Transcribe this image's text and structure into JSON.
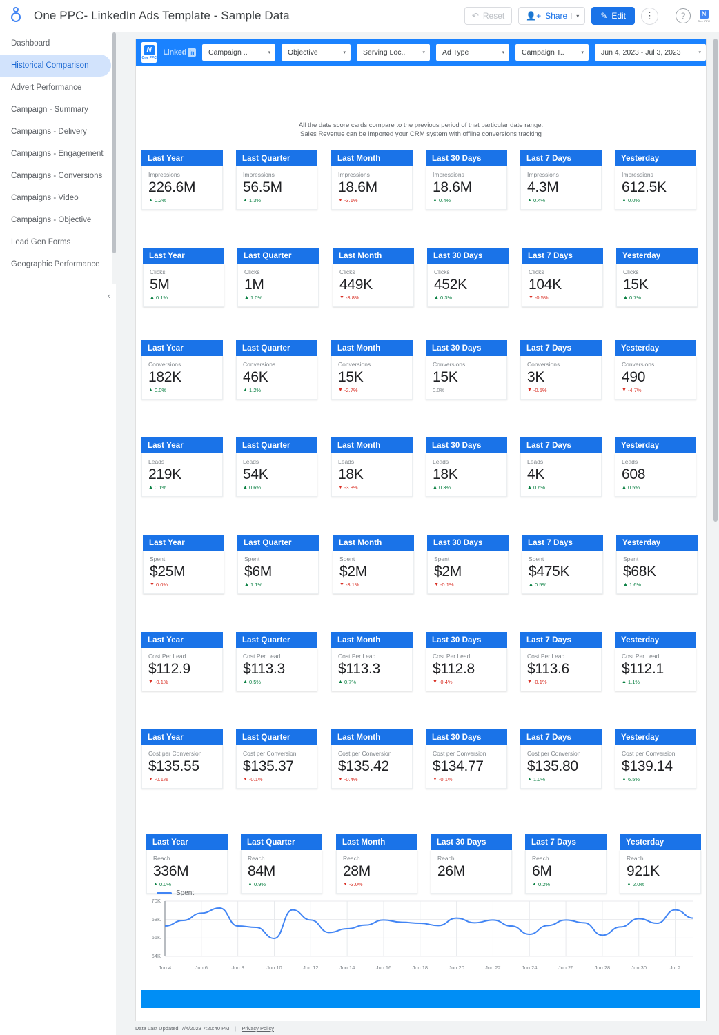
{
  "topbar": {
    "title": "One PPC- LinkedIn Ads Template - Sample Data",
    "reset_label": "Reset",
    "share_label": "Share",
    "share_caret": "▾",
    "edit_label": "Edit",
    "more_icon": "⋮",
    "help_icon": "?",
    "logo_mark": "N",
    "logo_text": "One PPC"
  },
  "sidebar": {
    "items": [
      {
        "label": "Dashboard",
        "active": false
      },
      {
        "label": "Historical Comparison",
        "active": true
      },
      {
        "label": "Advert Performance",
        "active": false
      },
      {
        "label": "Campaign - Summary",
        "active": false
      },
      {
        "label": "Campaigns - Delivery",
        "active": false
      },
      {
        "label": "Campaigns - Engagement",
        "active": false
      },
      {
        "label": "Campaigns - Conversions",
        "active": false
      },
      {
        "label": "Campaigns - Video",
        "active": false
      },
      {
        "label": "Campaigns - Objective",
        "active": false
      },
      {
        "label": "Lead Gen Forms",
        "active": false
      },
      {
        "label": "Geographic Performance",
        "active": false
      }
    ],
    "collapse_icon": "‹"
  },
  "filterbar": {
    "brand_mark": "N",
    "brand_text": "One PPC",
    "linkedin_word": "Linked",
    "linkedin_in": "in",
    "filters": [
      {
        "label": "Campaign ..",
        "caret": "▾"
      },
      {
        "label": "Objective",
        "caret": "▾"
      },
      {
        "label": "Serving Loc..",
        "caret": "▾"
      },
      {
        "label": "Ad Type",
        "caret": "▾"
      },
      {
        "label": "Campaign T..",
        "caret": "▾"
      },
      {
        "label": "Jun 4, 2023 - Jul 3, 2023",
        "caret": "▾"
      }
    ]
  },
  "note": {
    "line1": "All the date score cards compare to the previous period of that particular date range.",
    "line2": "Sales Revenue can be imported your CRM system with offline conversions tracking"
  },
  "periods": [
    "Last Year",
    "Last Quarter",
    "Last Month",
    "Last 30 Days",
    "Last 7 Days",
    "Yesterday"
  ],
  "scorecards": [
    {
      "metric": "Impressions",
      "cells": [
        {
          "value": "226.6M",
          "delta": "0.2%",
          "dir": "up"
        },
        {
          "value": "56.5M",
          "delta": "1.3%",
          "dir": "up"
        },
        {
          "value": "18.6M",
          "delta": "-3.1%",
          "dir": "down"
        },
        {
          "value": "18.6M",
          "delta": "0.4%",
          "dir": "up"
        },
        {
          "value": "4.3M",
          "delta": "0.4%",
          "dir": "up"
        },
        {
          "value": "612.5K",
          "delta": "0.0%",
          "dir": "up"
        }
      ]
    },
    {
      "metric": "Clicks",
      "cells": [
        {
          "value": "5M",
          "delta": "0.1%",
          "dir": "up"
        },
        {
          "value": "1M",
          "delta": "1.0%",
          "dir": "up"
        },
        {
          "value": "449K",
          "delta": "-3.8%",
          "dir": "down"
        },
        {
          "value": "452K",
          "delta": "0.3%",
          "dir": "up"
        },
        {
          "value": "104K",
          "delta": "-0.5%",
          "dir": "down"
        },
        {
          "value": "15K",
          "delta": "0.7%",
          "dir": "up"
        }
      ]
    },
    {
      "metric": "Conversions",
      "cells": [
        {
          "value": "182K",
          "delta": "0.0%",
          "dir": "up"
        },
        {
          "value": "46K",
          "delta": "1.2%",
          "dir": "up"
        },
        {
          "value": "15K",
          "delta": "-2.7%",
          "dir": "down"
        },
        {
          "value": "15K",
          "delta": "0.0%",
          "dir": "flat"
        },
        {
          "value": "3K",
          "delta": "-0.5%",
          "dir": "down"
        },
        {
          "value": "490",
          "delta": "-4.7%",
          "dir": "down"
        }
      ]
    },
    {
      "metric": "Leads",
      "cells": [
        {
          "value": "219K",
          "delta": "0.1%",
          "dir": "up"
        },
        {
          "value": "54K",
          "delta": "0.6%",
          "dir": "up"
        },
        {
          "value": "18K",
          "delta": "-3.8%",
          "dir": "down"
        },
        {
          "value": "18K",
          "delta": "0.3%",
          "dir": "up"
        },
        {
          "value": "4K",
          "delta": "0.6%",
          "dir": "up"
        },
        {
          "value": "608",
          "delta": "0.5%",
          "dir": "up"
        }
      ]
    },
    {
      "metric": "Spent",
      "cells": [
        {
          "value": "$25M",
          "delta": "0.0%",
          "dir": "down"
        },
        {
          "value": "$6M",
          "delta": "1.1%",
          "dir": "up"
        },
        {
          "value": "$2M",
          "delta": "-3.1%",
          "dir": "down"
        },
        {
          "value": "$2M",
          "delta": "-0.1%",
          "dir": "down"
        },
        {
          "value": "$475K",
          "delta": "0.5%",
          "dir": "up"
        },
        {
          "value": "$68K",
          "delta": "1.6%",
          "dir": "up"
        }
      ]
    },
    {
      "metric": "Cost Per Lead",
      "cells": [
        {
          "value": "$112.9",
          "delta": "-0.1%",
          "dir": "down"
        },
        {
          "value": "$113.3",
          "delta": "0.5%",
          "dir": "up"
        },
        {
          "value": "$113.3",
          "delta": "0.7%",
          "dir": "up"
        },
        {
          "value": "$112.8",
          "delta": "-0.4%",
          "dir": "down"
        },
        {
          "value": "$113.6",
          "delta": "-0.1%",
          "dir": "down"
        },
        {
          "value": "$112.1",
          "delta": "1.1%",
          "dir": "up"
        }
      ]
    },
    {
      "metric": "Cost per Conversion",
      "cells": [
        {
          "value": "$135.55",
          "delta": "-0.1%",
          "dir": "down"
        },
        {
          "value": "$135.37",
          "delta": "-0.1%",
          "dir": "down"
        },
        {
          "value": "$135.42",
          "delta": "-0.4%",
          "dir": "down"
        },
        {
          "value": "$134.77",
          "delta": "-0.1%",
          "dir": "down"
        },
        {
          "value": "$135.80",
          "delta": "1.0%",
          "dir": "up"
        },
        {
          "value": "$139.14",
          "delta": "6.5%",
          "dir": "up"
        }
      ]
    },
    {
      "metric": "Reach",
      "cells": [
        {
          "value": "336M",
          "delta": "0.0%",
          "dir": "up"
        },
        {
          "value": "84M",
          "delta": "0.9%",
          "dir": "up"
        },
        {
          "value": "28M",
          "delta": "-3.0%",
          "dir": "down"
        },
        {
          "value": "26M",
          "delta": "",
          "dir": "none"
        },
        {
          "value": "6M",
          "delta": "0.2%",
          "dir": "up"
        },
        {
          "value": "921K",
          "delta": "2.0%",
          "dir": "up"
        }
      ]
    }
  ],
  "chart_data": {
    "type": "line",
    "title": "",
    "xlabel": "",
    "ylabel": "",
    "legend": [
      "Spent"
    ],
    "legend_position": "top-left",
    "grid": true,
    "line_color": "#4285f4",
    "ylim": [
      64000,
      70000
    ],
    "yticks": [
      64000,
      66000,
      68000,
      70000
    ],
    "ytick_labels": [
      "64K",
      "66K",
      "68K",
      "70K"
    ],
    "xtick_labels": [
      "Jun 4",
      "Jun 6",
      "Jun 8",
      "Jun 10",
      "Jun 12",
      "Jun 14",
      "Jun 16",
      "Jun 18",
      "Jun 20",
      "Jun 22",
      "Jun 24",
      "Jun 26",
      "Jun 28",
      "Jun 30",
      "Jul 2"
    ],
    "categories": [
      "Jun 4",
      "Jun 5",
      "Jun 6",
      "Jun 7",
      "Jun 8",
      "Jun 9",
      "Jun 10",
      "Jun 11",
      "Jun 12",
      "Jun 13",
      "Jun 14",
      "Jun 15",
      "Jun 16",
      "Jun 17",
      "Jun 18",
      "Jun 19",
      "Jun 20",
      "Jun 21",
      "Jun 22",
      "Jun 23",
      "Jun 24",
      "Jun 25",
      "Jun 26",
      "Jun 27",
      "Jun 28",
      "Jun 29",
      "Jun 30",
      "Jul 1",
      "Jul 2",
      "Jul 3"
    ],
    "series": [
      {
        "name": "Spent",
        "values": [
          67300,
          67900,
          68700,
          69250,
          67300,
          67150,
          65950,
          69050,
          67950,
          66600,
          67000,
          67400,
          67950,
          67700,
          67600,
          67350,
          68150,
          67650,
          67950,
          67300,
          66400,
          67350,
          67950,
          67650,
          66300,
          67200,
          68100,
          67600,
          69050,
          68150
        ]
      }
    ]
  },
  "footer": {
    "updated_label": "Data Last Updated: 7/4/2023 7:20:40 PM",
    "privacy_label": "Privacy Policy"
  }
}
